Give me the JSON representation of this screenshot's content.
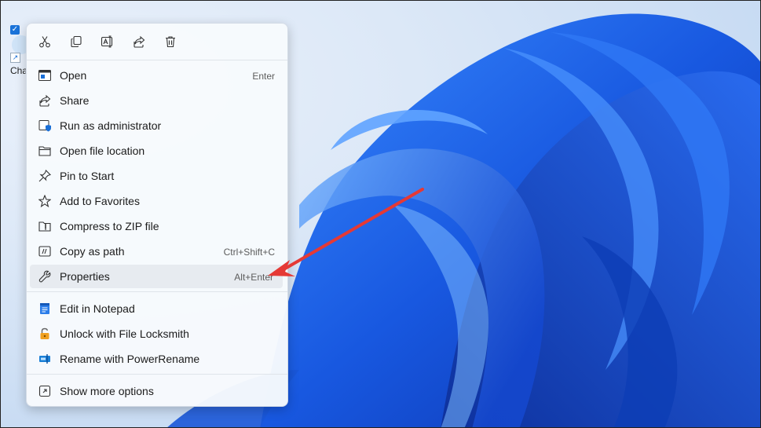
{
  "desktop": {
    "icon_label": "Cha"
  },
  "toolbar": {
    "buttons": [
      "cut-icon",
      "copy-icon",
      "rename-icon",
      "share-icon",
      "delete-icon"
    ]
  },
  "menu": {
    "open": {
      "label": "Open",
      "shortcut": "Enter"
    },
    "share": {
      "label": "Share"
    },
    "run_admin": {
      "label": "Run as administrator"
    },
    "open_location": {
      "label": "Open file location"
    },
    "pin_start": {
      "label": "Pin to Start"
    },
    "add_fav": {
      "label": "Add to Favorites"
    },
    "compress": {
      "label": "Compress to ZIP file"
    },
    "copy_path": {
      "label": "Copy as path",
      "shortcut": "Ctrl+Shift+C"
    },
    "properties": {
      "label": "Properties",
      "shortcut": "Alt+Enter"
    },
    "notepad": {
      "label": "Edit in Notepad"
    },
    "locksmith": {
      "label": "Unlock with File Locksmith"
    },
    "powerrename": {
      "label": "Rename with PowerRename"
    },
    "more": {
      "label": "Show more options"
    }
  },
  "colors": {
    "accent": "#1a6fd6",
    "arrow": "#e53935",
    "wallpaper": "#1f5fe0"
  }
}
